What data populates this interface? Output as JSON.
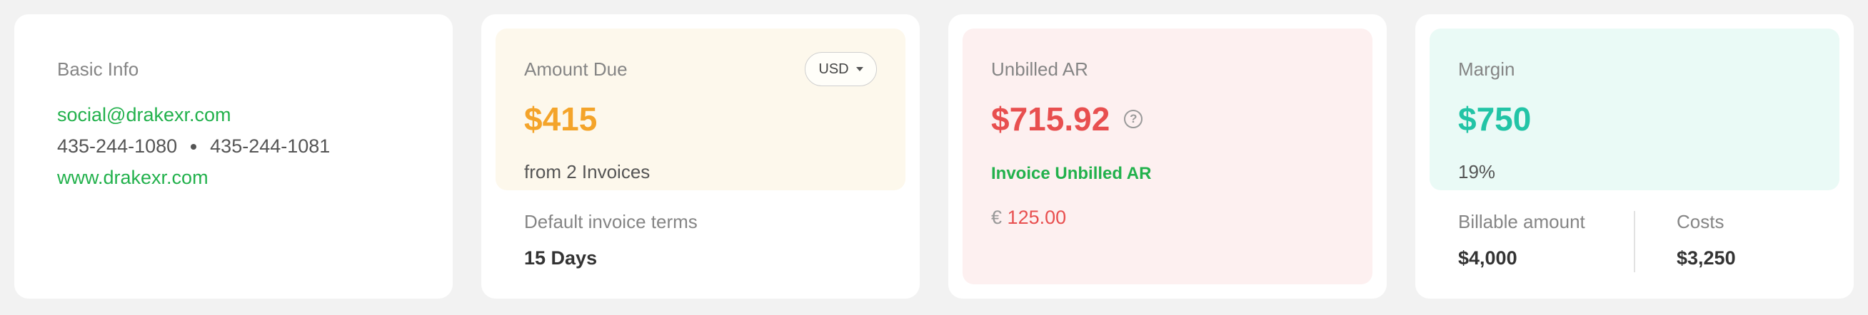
{
  "basic_info": {
    "title": "Basic Info",
    "email": "social@drakexr.com",
    "phone_1": "435-244-1080",
    "phone_2": "435-244-1081",
    "website": "www.drakexr.com"
  },
  "amount_due": {
    "title": "Amount Due",
    "currency": "USD",
    "amount": "$415",
    "subtitle": "from 2 Invoices",
    "terms_label": "Default invoice terms",
    "terms_value": "15 Days"
  },
  "unbilled_ar": {
    "title": "Unbilled AR",
    "amount": "$715.92",
    "help_icon": "question-circle-icon",
    "link_label": "Invoice Unbilled AR",
    "euro_symbol": "€",
    "euro_amount": "125.00"
  },
  "margin": {
    "title": "Margin",
    "amount": "$750",
    "percent": "19%",
    "billable_label": "Billable amount",
    "billable_value": "$4,000",
    "costs_label": "Costs",
    "costs_value": "$3,250"
  },
  "colors": {
    "link_green": "#22b14c",
    "amount_due_orange": "#f4a42a",
    "unbilled_red": "#e84f4f",
    "margin_teal": "#22c4a6"
  }
}
